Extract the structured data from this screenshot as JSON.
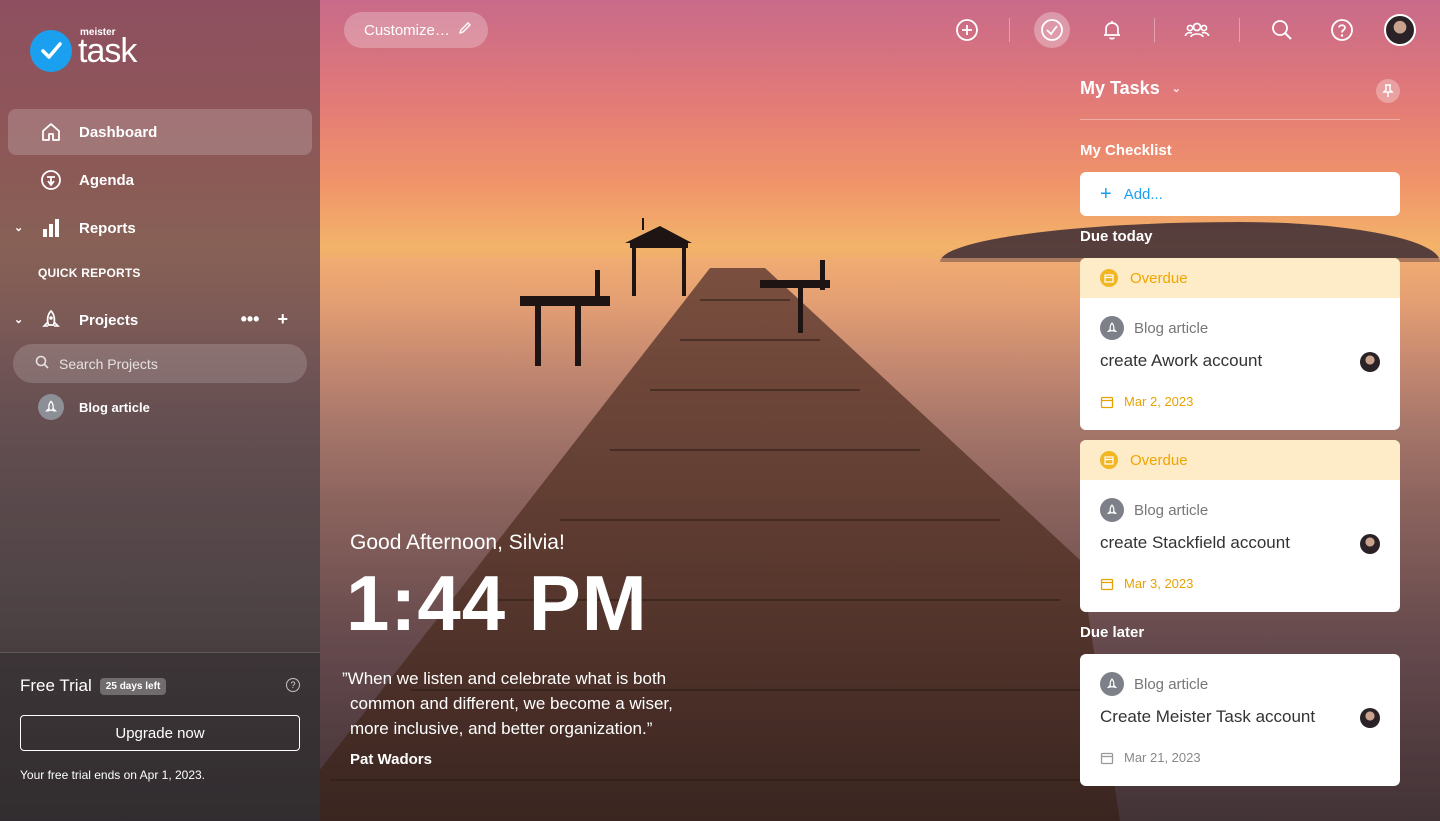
{
  "app": {
    "brand_top": "meister",
    "brand": "task"
  },
  "sidebar": {
    "items": [
      {
        "label": "Dashboard",
        "icon": "home-icon"
      },
      {
        "label": "Agenda",
        "icon": "agenda-icon"
      },
      {
        "label": "Reports",
        "icon": "bar-chart-icon"
      }
    ],
    "quick_reports": "QUICK REPORTS",
    "projects_label": "Projects",
    "projects_more": "•••",
    "projects_add": "+",
    "search_placeholder": "Search Projects",
    "project_items": [
      {
        "label": "Blog article"
      }
    ]
  },
  "trial": {
    "title": "Free Trial",
    "badge": "25 days left",
    "help": "?",
    "upgrade": "Upgrade now",
    "note": "Your free trial ends on Apr 1, 2023."
  },
  "topbar": {
    "customize": "Customize…"
  },
  "hero": {
    "greeting": "Good Afternoon, Silvia!",
    "time": "1:44 PM",
    "quote": "”When we listen and celebrate what is both common and different, we become a wiser, more inclusive, and better organization.”",
    "author": "Pat Wadors"
  },
  "panel": {
    "title": "My Tasks",
    "checklist": "My Checklist",
    "add": "Add...",
    "due_today": "Due today",
    "due_later": "Due later",
    "tasks": [
      {
        "status": "Overdue",
        "project": "Blog article",
        "title": "create Awork account",
        "date": "Mar 2, 2023"
      },
      {
        "status": "Overdue",
        "project": "Blog article",
        "title": "create Stackfield account",
        "date": "Mar 3, 2023"
      },
      {
        "status": "",
        "project": "Blog article",
        "title": "Create Meister Task account",
        "date": "Mar 21, 2023"
      }
    ]
  },
  "colors": {
    "accent": "#1aa0ef",
    "overdue": "#f0a500",
    "overdue_bg": "#fdecc7"
  }
}
